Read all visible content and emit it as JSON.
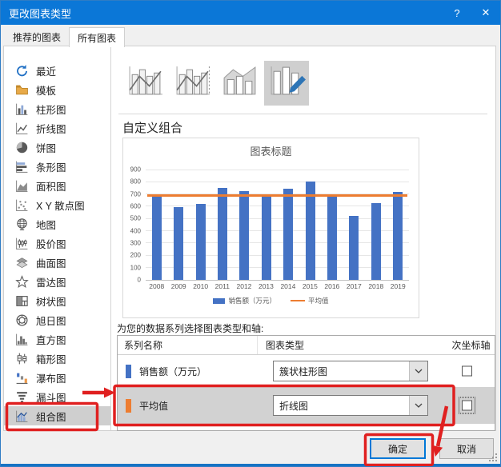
{
  "window": {
    "title": "更改图表类型",
    "help_icon": "?",
    "close_icon": "✕"
  },
  "tabs": [
    {
      "label": "推荐的图表",
      "active": false
    },
    {
      "label": "所有图表",
      "active": true
    }
  ],
  "sidebar": {
    "items": [
      {
        "icon": "recent-icon",
        "label": "最近",
        "selected": false
      },
      {
        "icon": "template-icon",
        "label": "模板",
        "selected": false
      },
      {
        "icon": "column-chart-icon",
        "label": "柱形图",
        "selected": false
      },
      {
        "icon": "line-chart-icon",
        "label": "折线图",
        "selected": false
      },
      {
        "icon": "pie-chart-icon",
        "label": "饼图",
        "selected": false
      },
      {
        "icon": "bar-chart-icon",
        "label": "条形图",
        "selected": false
      },
      {
        "icon": "area-chart-icon",
        "label": "面积图",
        "selected": false
      },
      {
        "icon": "scatter-chart-icon",
        "label": "X Y 散点图",
        "selected": false
      },
      {
        "icon": "map-chart-icon",
        "label": "地图",
        "selected": false
      },
      {
        "icon": "stock-chart-icon",
        "label": "股价图",
        "selected": false
      },
      {
        "icon": "surface-chart-icon",
        "label": "曲面图",
        "selected": false
      },
      {
        "icon": "radar-chart-icon",
        "label": "雷达图",
        "selected": false
      },
      {
        "icon": "treemap-chart-icon",
        "label": "树状图",
        "selected": false
      },
      {
        "icon": "sunburst-chart-icon",
        "label": "旭日图",
        "selected": false
      },
      {
        "icon": "histogram-chart-icon",
        "label": "直方图",
        "selected": false
      },
      {
        "icon": "box-whisker-chart-icon",
        "label": "箱形图",
        "selected": false
      },
      {
        "icon": "waterfall-chart-icon",
        "label": "瀑布图",
        "selected": false
      },
      {
        "icon": "funnel-chart-icon",
        "label": "漏斗图",
        "selected": false
      },
      {
        "icon": "combo-chart-icon",
        "label": "组合图",
        "selected": true
      }
    ]
  },
  "combo_subtypes": {
    "items": [
      {
        "icon": "clustered-column-line-icon",
        "selected": false
      },
      {
        "icon": "clustered-column-line-secondary-axis-icon",
        "selected": false
      },
      {
        "icon": "stacked-area-clustered-column-icon",
        "selected": false
      },
      {
        "icon": "custom-combination-icon",
        "selected": true
      }
    ]
  },
  "section_heading": "自定义组合",
  "chart_data": {
    "type": "combo",
    "title": "图表标题",
    "categories": [
      "2008",
      "2009",
      "2010",
      "2011",
      "2012",
      "2013",
      "2014",
      "2015",
      "2016",
      "2017",
      "2018",
      "2019"
    ],
    "series": [
      {
        "name": "销售额（万元）",
        "chart_type": "bar",
        "color": "#4472c4",
        "values": [
          680,
          595,
          620,
          750,
          722,
          688,
          745,
          800,
          700,
          520,
          628,
          715
        ]
      },
      {
        "name": "平均值",
        "chart_type": "line",
        "color": "#ed7d31",
        "values": [
          690,
          690,
          690,
          690,
          690,
          690,
          690,
          690,
          690,
          690,
          690,
          690
        ]
      }
    ],
    "ylim": [
      0,
      900
    ],
    "ytick_step": 100,
    "grid": true,
    "legend_position": "bottom"
  },
  "series_table": {
    "intro": "为您的数据系列选择图表类型和轴:",
    "headers": [
      "系列名称",
      "图表类型",
      "次坐标轴"
    ],
    "rows": [
      {
        "name": "销售额（万元）",
        "swatch_color": "#4472c4",
        "chart_type": "簇状柱形图",
        "secondary_axis_checked": false,
        "selected": false,
        "focused": false
      },
      {
        "name": "平均值",
        "swatch_color": "#ed7d31",
        "chart_type": "折线图",
        "secondary_axis_checked": false,
        "selected": true,
        "focused": true
      }
    ]
  },
  "footer": {
    "ok_label": "确定",
    "cancel_label": "取消"
  },
  "colors": {
    "titlebar_blue": "#0b77d7",
    "bar_blue": "#4472c4",
    "line_orange": "#ed7d31",
    "annotation_red": "#e02020",
    "selected_gray": "#cfcfcf"
  }
}
